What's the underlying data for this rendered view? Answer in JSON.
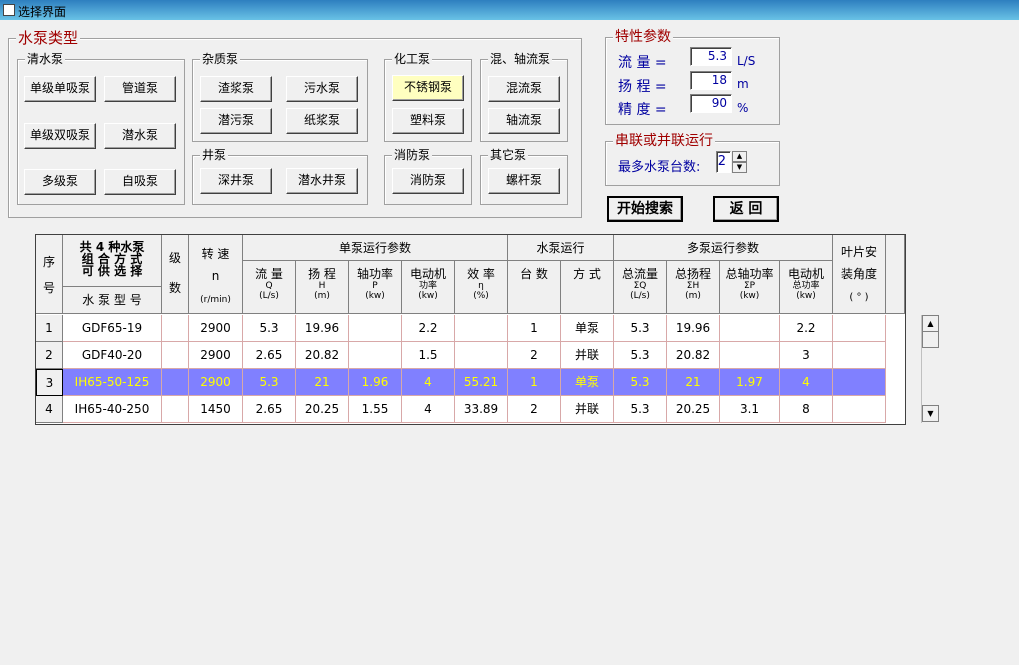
{
  "window": {
    "title": "选择界面"
  },
  "pump_types": {
    "title": "水泵类型",
    "clear": {
      "label": "清水泵",
      "buttons": [
        "单级单吸泵",
        "管道泵",
        "单级双吸泵",
        "潜水泵",
        "多级泵",
        "自吸泵"
      ]
    },
    "sundries": {
      "label": "杂质泵",
      "buttons": [
        "渣浆泵",
        "污水泵",
        "潜污泵",
        "纸浆泵"
      ]
    },
    "chemical": {
      "label": "化工泵",
      "buttons": [
        "不锈钢泵",
        "塑料泵"
      ]
    },
    "mixed": {
      "label": "混、轴流泵",
      "buttons": [
        "混流泵",
        "轴流泵"
      ]
    },
    "well": {
      "label": "井泵",
      "buttons": [
        "深井泵",
        "潜水井泵"
      ]
    },
    "fire": {
      "label": "消防泵",
      "buttons": [
        "消防泵"
      ]
    },
    "other": {
      "label": "其它泵",
      "buttons": [
        "螺杆泵"
      ]
    }
  },
  "params": {
    "title": "特性参数",
    "flow_label": "流  量 =",
    "flow_value": "5.3",
    "flow_unit": "L/S",
    "head_label": "扬  程 =",
    "head_value": "18",
    "head_unit": "m",
    "precision_label": "精  度 =",
    "precision_value": "90",
    "precision_unit": "%"
  },
  "serial": {
    "title": "串联或并联运行",
    "label": "最多水泵台数:",
    "value": "2"
  },
  "actions": {
    "search": "开始搜索",
    "back": "返  回"
  },
  "table": {
    "h_seq": "序",
    "h_seq2": "号",
    "h_combo1": "共 4 种水泵",
    "h_combo2": "组 合 方 式",
    "h_combo3": "可 供 选 择",
    "h_model": "水 泵 型 号",
    "h_stage1": "级",
    "h_stage2": "数",
    "h_speed1": "转  速",
    "h_speed2": "n",
    "h_speed3": "(r/min)",
    "h_single": "单泵运行参数",
    "h_run": "水泵运行",
    "h_multi": "多泵运行参数",
    "h_blade1": "叶片安",
    "h_blade2": "装角度",
    "h_blade3": "( ° )",
    "sub": [
      {
        "a": "流  量",
        "b": "Q",
        "c": "(L/s)"
      },
      {
        "a": "扬  程",
        "b": "H",
        "c": "(m)"
      },
      {
        "a": "轴功率",
        "b": "P",
        "c": "(kw)"
      },
      {
        "a": "电动机",
        "b": "功率",
        "c": "(kw)"
      },
      {
        "a": "效  率",
        "b": "η",
        "c": "(%)"
      },
      {
        "a": "台  数",
        "b": "",
        "c": ""
      },
      {
        "a": "方  式",
        "b": "",
        "c": ""
      },
      {
        "a": "总流量",
        "b": "ΣQ",
        "c": "(L/s)"
      },
      {
        "a": "总扬程",
        "b": "ΣH",
        "c": "(m)"
      },
      {
        "a": "总轴功率",
        "b": "ΣP",
        "c": "(kw)"
      },
      {
        "a": "电动机",
        "b": "总功率",
        "c": "(kw)"
      }
    ],
    "rows": [
      {
        "n": "1",
        "model": "GDF65-19",
        "stage": "",
        "speed": "2900",
        "q": "5.3",
        "h": "19.96",
        "p": "",
        "motor": "2.2",
        "eff": "",
        "count": "1",
        "mode": "单泵",
        "tq": "5.3",
        "th": "19.96",
        "tp": "",
        "tm": "2.2",
        "blade": ""
      },
      {
        "n": "2",
        "model": "GDF40-20",
        "stage": "",
        "speed": "2900",
        "q": "2.65",
        "h": "20.82",
        "p": "",
        "motor": "1.5",
        "eff": "",
        "count": "2",
        "mode": "并联",
        "tq": "5.3",
        "th": "20.82",
        "tp": "",
        "tm": "3",
        "blade": ""
      },
      {
        "n": "3",
        "model": "IH65-50-125",
        "stage": "",
        "speed": "2900",
        "q": "5.3",
        "h": "21",
        "p": "1.96",
        "motor": "4",
        "eff": "55.21",
        "count": "1",
        "mode": "单泵",
        "tq": "5.3",
        "th": "21",
        "tp": "1.97",
        "tm": "4",
        "blade": ""
      },
      {
        "n": "4",
        "model": "IH65-40-250",
        "stage": "",
        "speed": "1450",
        "q": "2.65",
        "h": "20.25",
        "p": "1.55",
        "motor": "4",
        "eff": "33.89",
        "count": "2",
        "mode": "并联",
        "tq": "5.3",
        "th": "20.25",
        "tp": "3.1",
        "tm": "8",
        "blade": ""
      }
    ],
    "selected_row": 3
  },
  "colors": {
    "title_red": "#a00000",
    "label_blue": "#0000a0",
    "selection": "#8080ff",
    "selection_text": "#ffff00"
  }
}
